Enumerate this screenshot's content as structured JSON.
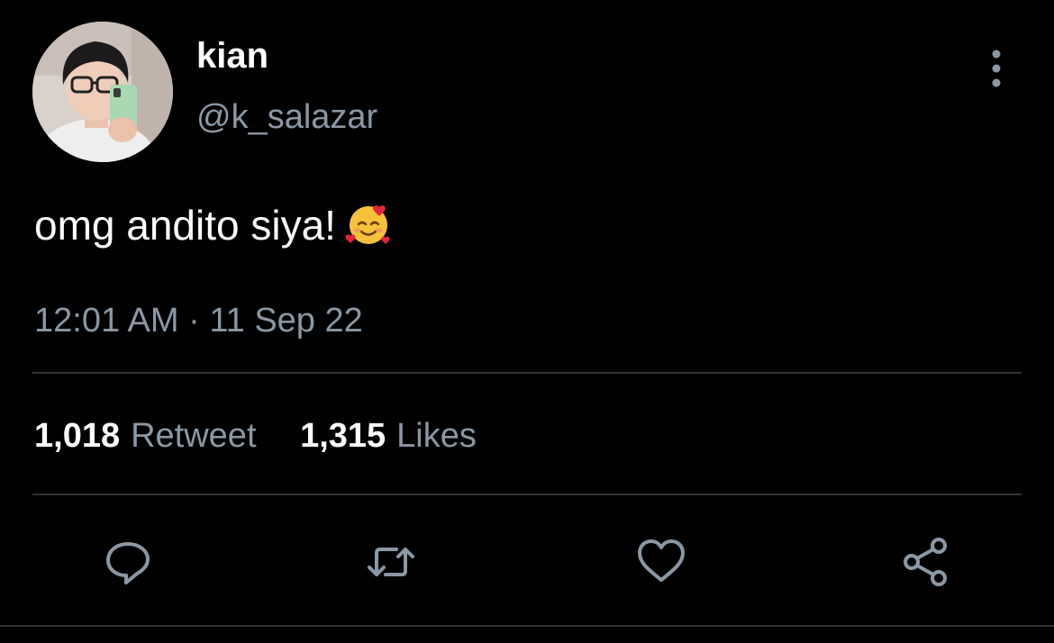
{
  "tweet": {
    "author": {
      "display_name": "kian",
      "handle": "@k_salazar",
      "avatar_icon": "profile-photo"
    },
    "text": "omg andito siya!",
    "emoji": "smiling-face-with-hearts",
    "timestamp": "12:01 AM · 11 Sep 22",
    "stats": {
      "retweets_count": "1,018",
      "retweets_label": "Retweet",
      "likes_count": "1,315",
      "likes_label": "Likes"
    },
    "actions": [
      "reply-icon",
      "retweet-icon",
      "like-icon",
      "share-icon"
    ]
  },
  "colors": {
    "background": "#000000",
    "primary_text": "#ffffff",
    "secondary_text": "#8b98a5",
    "divider": "#2f3336"
  }
}
